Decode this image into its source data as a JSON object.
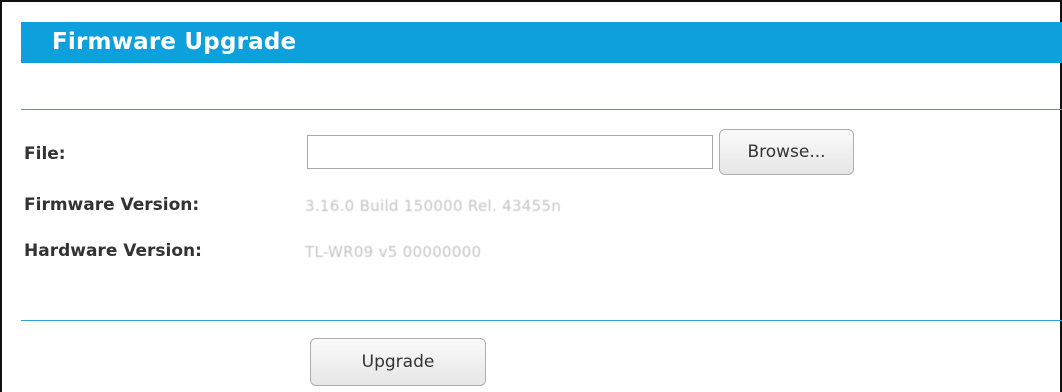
{
  "header": {
    "title": "Firmware Upgrade"
  },
  "form": {
    "file_label": "File:",
    "file_value": "",
    "browse_label": "Browse...",
    "firmware_label": "Firmware Version:",
    "firmware_value": "3.16.0 Build 150000 Rel. 43455n",
    "hardware_label": "Hardware Version:",
    "hardware_value": "TL-WR09 v5 00000000",
    "upgrade_label": "Upgrade"
  },
  "colors": {
    "header_bg": "#0ea0dc",
    "divider": "#2ea3db",
    "label_text": "#333333"
  }
}
